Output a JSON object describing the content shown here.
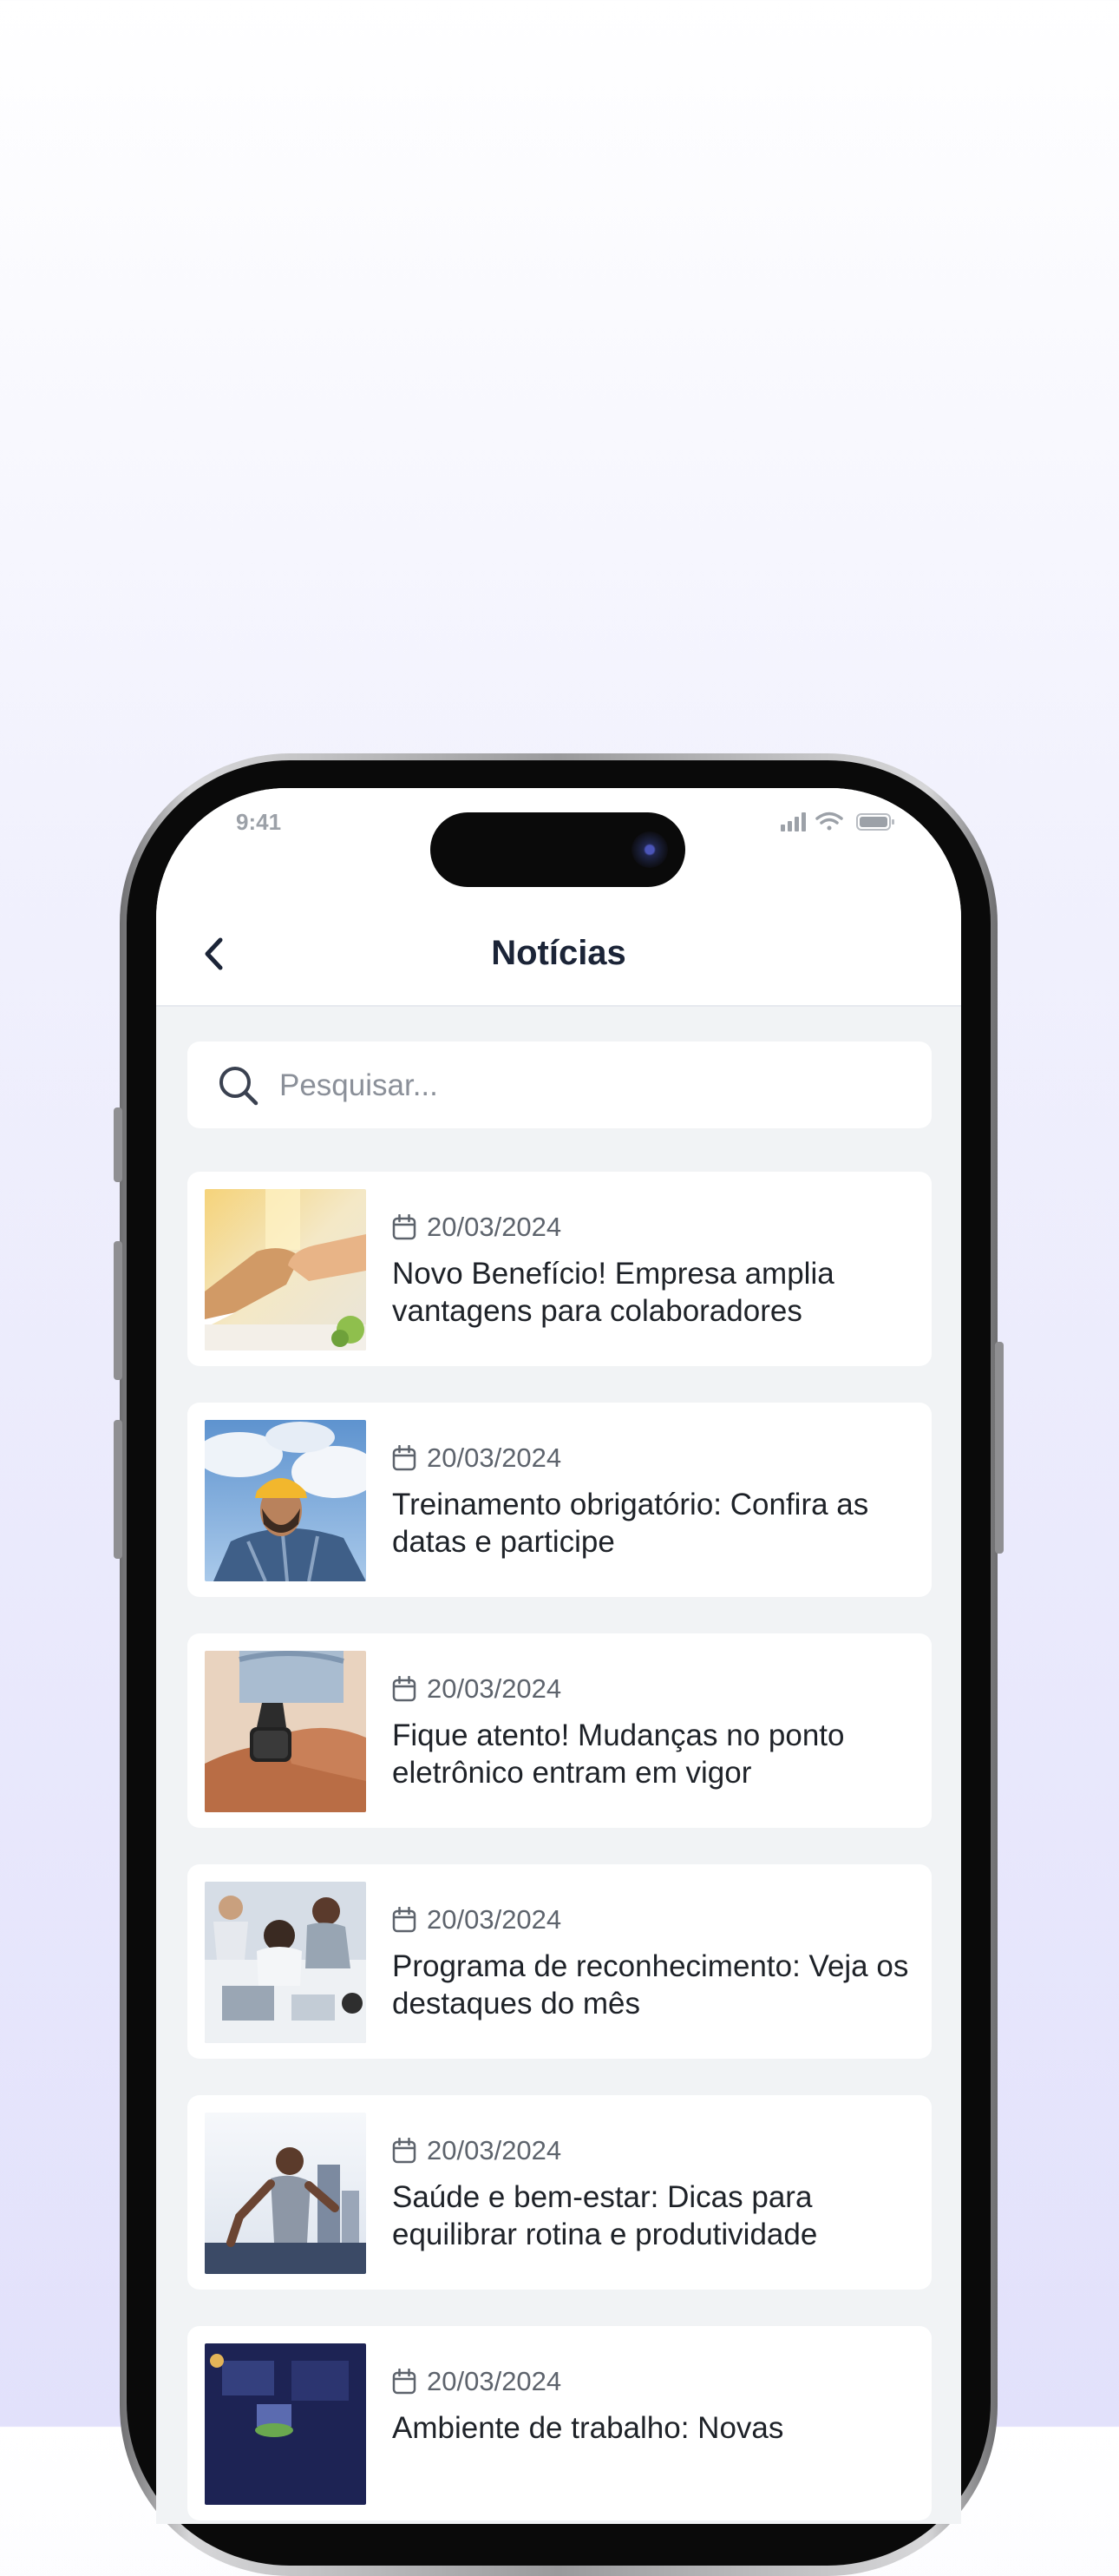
{
  "status_bar": {
    "time": "9:41",
    "icons": [
      "signal-icon",
      "wifi-icon",
      "battery-icon"
    ]
  },
  "header": {
    "title": "Notícias",
    "back_icon": "chevron-left-icon"
  },
  "search": {
    "placeholder": "Pesquisar...",
    "value": "",
    "icon": "search-icon"
  },
  "news": [
    {
      "date": "20/03/2024",
      "title": "Novo Benefício! Empresa amplia vantagens para colaboradores",
      "image": "handshake-photo"
    },
    {
      "date": "20/03/2024",
      "title": "Treinamento obrigatório: Confira as datas e participe",
      "image": "worker-hardhat-photo"
    },
    {
      "date": "20/03/2024",
      "title": "Fique atento! Mudanças no ponto eletrônico entram em vigor",
      "image": "smartwatch-photo"
    },
    {
      "date": "20/03/2024",
      "title": "Programa de reconhecimento: Veja os destaques do mês",
      "image": "team-meeting-photo"
    },
    {
      "date": "20/03/2024",
      "title": "Saúde e bem-estar: Dicas para equilibrar rotina e produtividade",
      "image": "runner-photo"
    },
    {
      "date": "20/03/2024",
      "title": "Ambiente de trabalho: Novas",
      "image": "office-night-photo"
    }
  ],
  "colors": {
    "title": "#1b2437",
    "screen_bg": "#f1f3f5",
    "card_bg": "#ffffff",
    "muted_text": "#5d636c"
  }
}
